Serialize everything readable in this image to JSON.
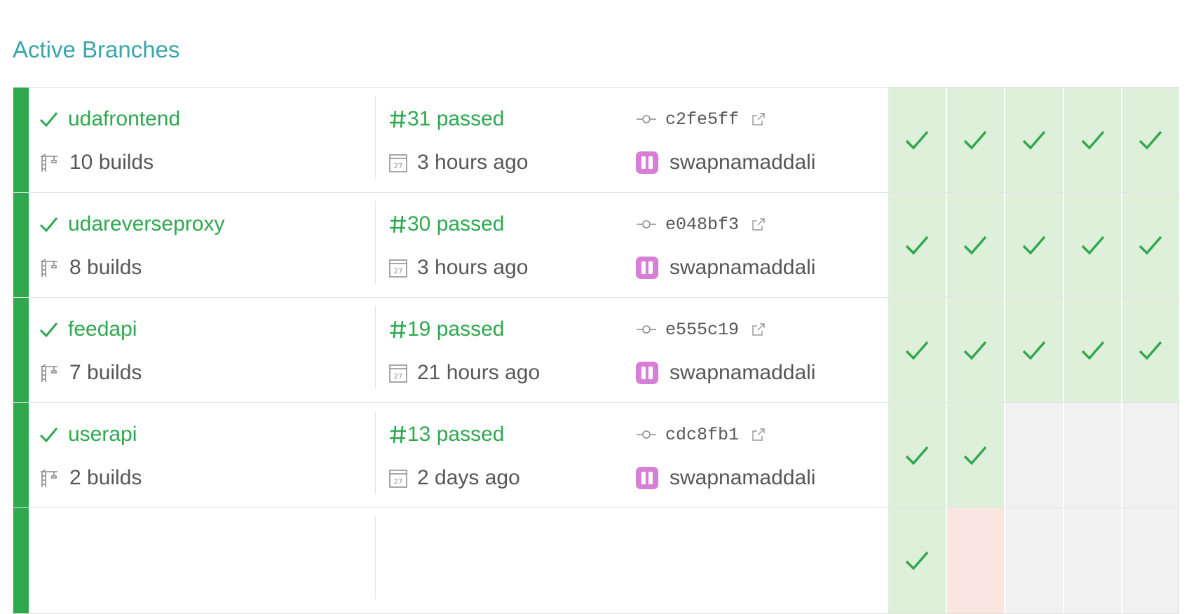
{
  "page": {
    "title": "Active Branches"
  },
  "colors": {
    "passed": "#2fa84f",
    "title": "#3ba5a8",
    "avatar": "#d77fd6",
    "failed": "#fbe5e1",
    "empty": "#f1f1f1"
  },
  "branches": [
    {
      "name": "udafrontend",
      "status_icon": "check-icon",
      "builds_count": "10 builds",
      "build_label": "31 passed",
      "time_ago": "3 hours ago",
      "commit_sha": "c2fe5ff",
      "author": "swapnamaddali",
      "history": [
        "passed",
        "passed",
        "passed",
        "passed",
        "passed"
      ]
    },
    {
      "name": "udareverseproxy",
      "status_icon": "check-icon",
      "builds_count": "8 builds",
      "build_label": "30 passed",
      "time_ago": "3 hours ago",
      "commit_sha": "e048bf3",
      "author": "swapnamaddali",
      "history": [
        "passed",
        "passed",
        "passed",
        "passed",
        "passed"
      ]
    },
    {
      "name": "feedapi",
      "status_icon": "check-icon",
      "builds_count": "7 builds",
      "build_label": "19 passed",
      "time_ago": "21 hours ago",
      "commit_sha": "e555c19",
      "author": "swapnamaddali",
      "history": [
        "passed",
        "passed",
        "passed",
        "passed",
        "passed"
      ]
    },
    {
      "name": "userapi",
      "status_icon": "check-icon",
      "builds_count": "2 builds",
      "build_label": "13 passed",
      "time_ago": "2 days ago",
      "commit_sha": "cdc8fb1",
      "author": "swapnamaddali",
      "history": [
        "passed",
        "passed",
        "empty",
        "empty",
        "empty"
      ]
    },
    {
      "name": "",
      "status_icon": "",
      "builds_count": "",
      "build_label": "",
      "time_ago": "",
      "commit_sha": "",
      "author": "",
      "history": [
        "passed",
        "failed",
        "empty",
        "empty",
        "empty"
      ],
      "partial": true
    }
  ]
}
